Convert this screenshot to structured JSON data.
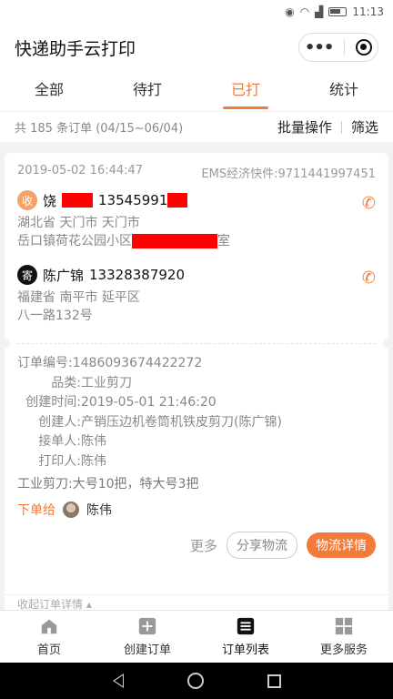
{
  "status_bar": {
    "time": "11:13"
  },
  "header": {
    "title": "快递助手云打印"
  },
  "tabs": [
    {
      "label": "全部",
      "active": false
    },
    {
      "label": "待打",
      "active": false
    },
    {
      "label": "已打",
      "active": true
    },
    {
      "label": "统计",
      "active": false
    }
  ],
  "subbar": {
    "summary": "共 185 条订单 (04/15~06/04)",
    "bulk_label": "批量操作",
    "filter_label": "筛选"
  },
  "order": {
    "datetime": "2019-05-02 16:44:47",
    "carrier": "EMS经济快件:9711441997451",
    "receiver": {
      "badge": "收",
      "name_prefix": "饶",
      "phone": "13545991",
      "province_line": "湖北省 天门市 天门市",
      "street_prefix": "岳口镇荷花公园小区",
      "street_suffix": "室"
    },
    "sender": {
      "badge": "寄",
      "name": "陈广锦",
      "phone": "13328387920",
      "province_line": "福建省 南平市 延平区",
      "street": "八一路132号"
    },
    "details": {
      "order_no_label": "订单编号:",
      "order_no": "1486093674422272",
      "category_label": "品类:",
      "category": "工业剪刀",
      "created_label": "创建时间:",
      "created": "2019-05-01 21:46:20",
      "creator_label": "创建人:",
      "creator": "产销压边机卷筒机铁皮剪刀(陈广锦)",
      "taker_label": "接单人:",
      "taker": "陈伟",
      "printer_label": "打印人:",
      "printer": "陈伟",
      "note": "工业剪刀:大号10把，特大号3把"
    },
    "assign": {
      "label": "下单给",
      "name": "陈伟"
    },
    "actions": {
      "more": "更多",
      "share": "分享物流",
      "detail": "物流详情"
    },
    "collapse_label": "收起订单详情"
  },
  "tabbar": [
    {
      "label": "首页",
      "icon": "home-icon"
    },
    {
      "label": "创建订单",
      "icon": "plus-icon"
    },
    {
      "label": "订单列表",
      "icon": "list-icon"
    },
    {
      "label": "更多服务",
      "icon": "grid-icon"
    }
  ],
  "colors": {
    "accent": "#f47a3a",
    "redaction": "#ff0000"
  }
}
